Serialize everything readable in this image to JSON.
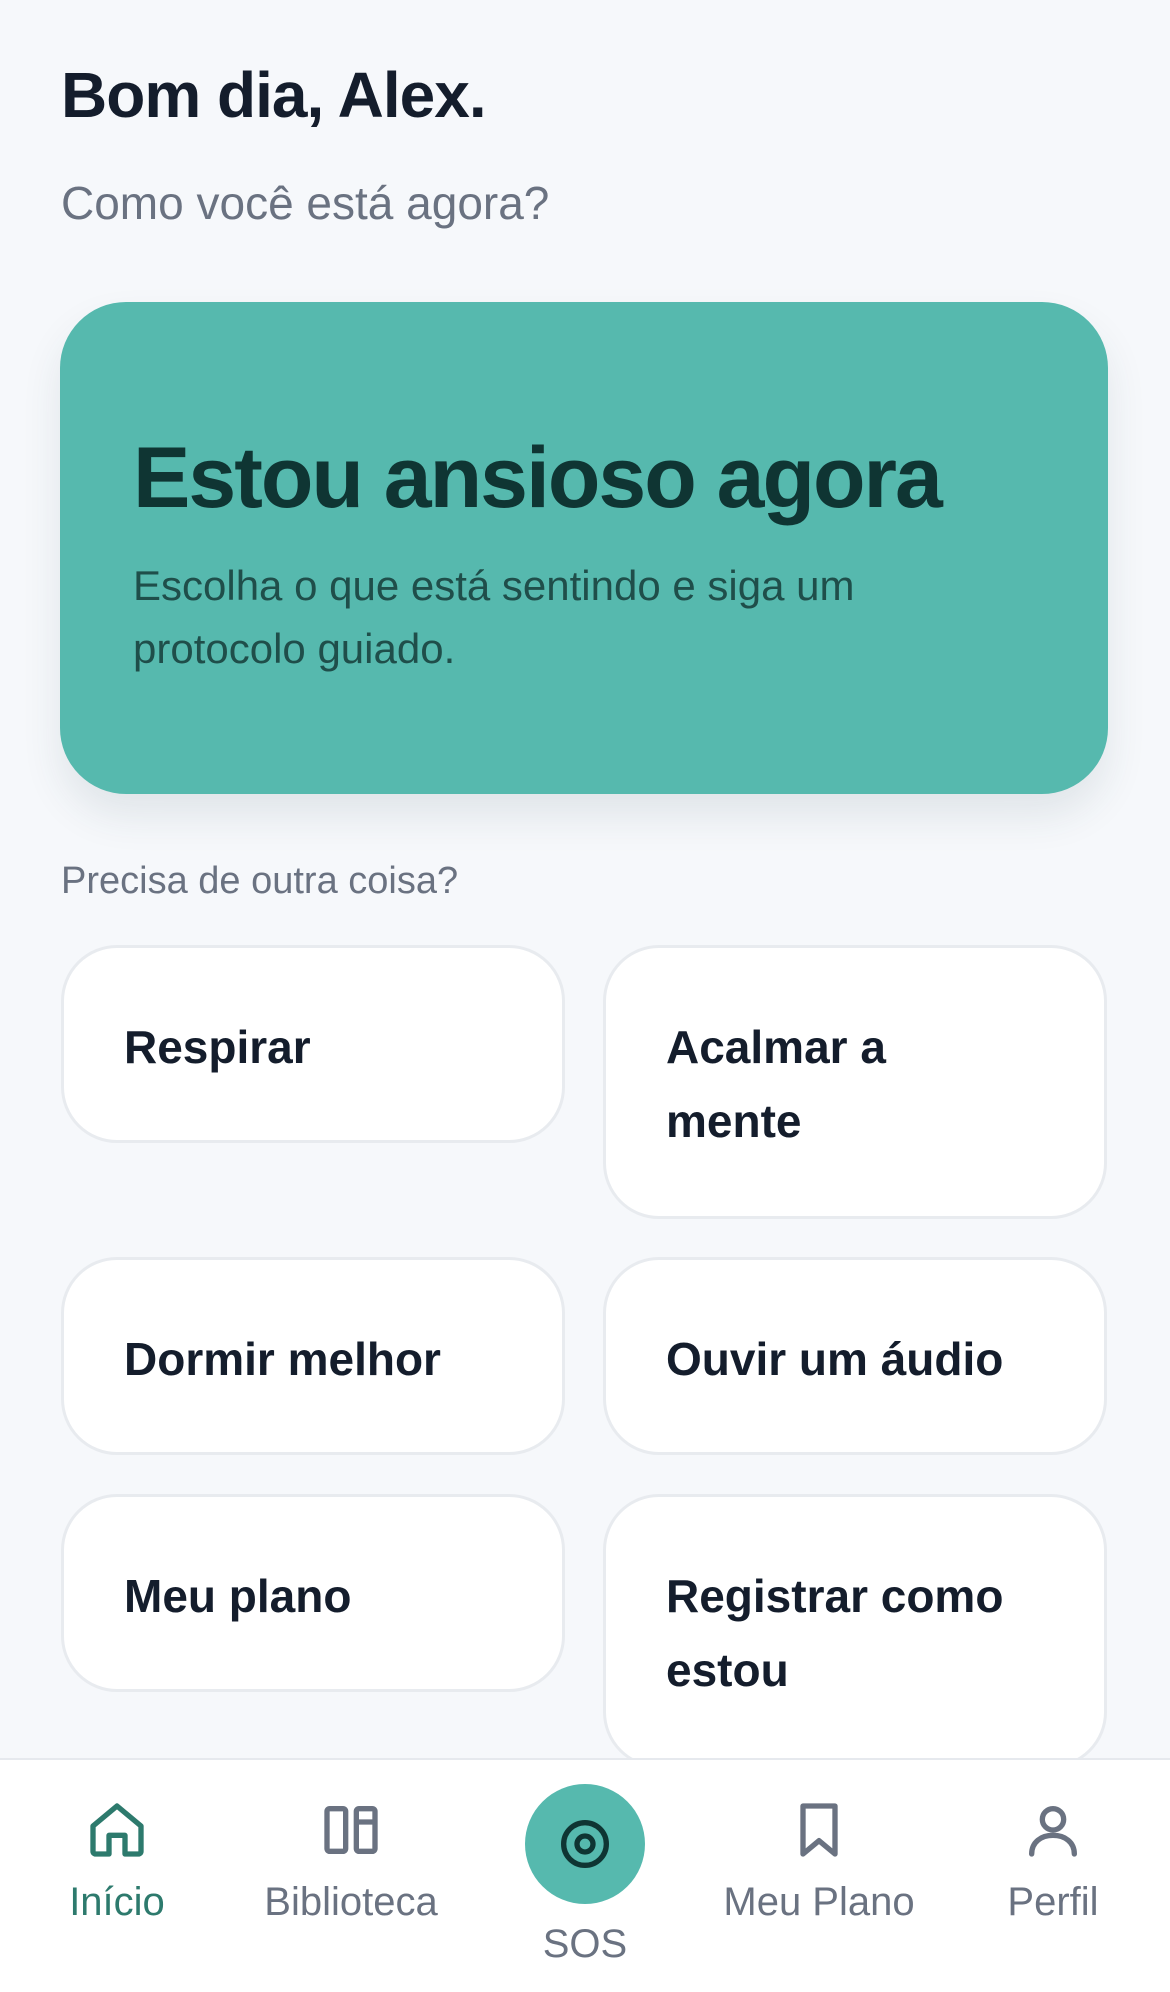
{
  "header": {
    "greeting": "Bom dia, Alex.",
    "subtitle": "Como você está agora?"
  },
  "hero": {
    "title": "Estou ansioso agora",
    "description": "Escolha o que está sentindo e siga um protocolo guiado."
  },
  "options": {
    "label": "Precisa de outra coisa?",
    "items": [
      {
        "label": "Respirar"
      },
      {
        "label": "Acalmar a mente"
      },
      {
        "label": "Dormir melhor"
      },
      {
        "label": "Ouvir um áudio"
      },
      {
        "label": "Meu plano"
      },
      {
        "label": "Registrar como estou"
      }
    ]
  },
  "tabbar": {
    "items": [
      {
        "label": "Início",
        "icon": "home-icon",
        "active": true
      },
      {
        "label": "Biblioteca",
        "icon": "library-icon",
        "active": false
      },
      {
        "label": "SOS",
        "icon": "sos-icon",
        "active": false
      },
      {
        "label": "Meu Plano",
        "icon": "bookmark-icon",
        "active": false
      },
      {
        "label": "Perfil",
        "icon": "user-icon",
        "active": false
      }
    ]
  },
  "colors": {
    "accent": "#56b9ae",
    "active_tab": "#2d7a6d",
    "background": "#f6f8fb",
    "text_primary": "#141d2c",
    "text_secondary": "#6a7281"
  }
}
